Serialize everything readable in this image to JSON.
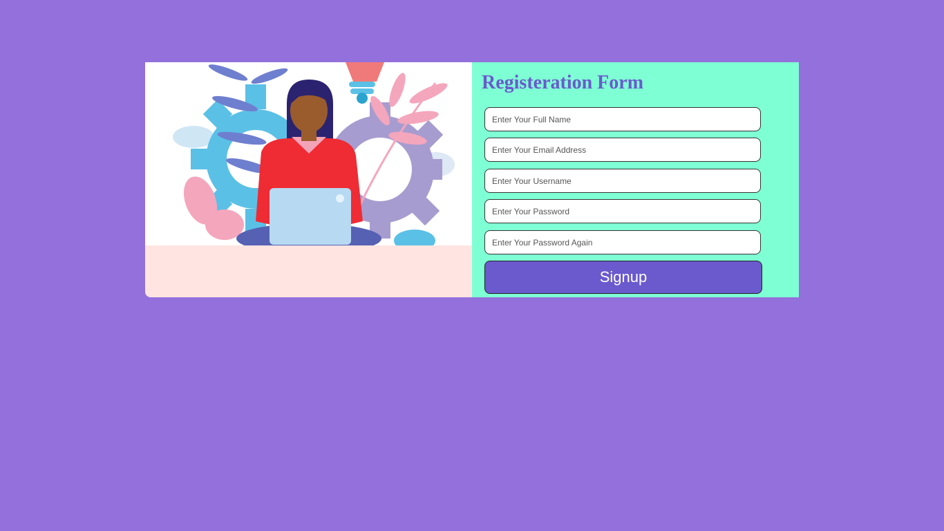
{
  "form": {
    "title": "Registeration Form",
    "fields": [
      {
        "placeholder": "Enter Your Full Name",
        "value": ""
      },
      {
        "placeholder": "Enter Your Email Address",
        "value": ""
      },
      {
        "placeholder": "Enter Your Username",
        "value": ""
      },
      {
        "placeholder": "Enter Your Password",
        "value": ""
      },
      {
        "placeholder": "Enter Your Password Again",
        "value": ""
      }
    ],
    "submit_label": "Signup"
  },
  "colors": {
    "page_background": "#9370DB",
    "form_panel": "#7FFFD4",
    "illustration_panel": "#FFE4E1",
    "accent": "#6A5ACD"
  },
  "illustration": {
    "icon": "woman-with-laptop-illustration"
  }
}
